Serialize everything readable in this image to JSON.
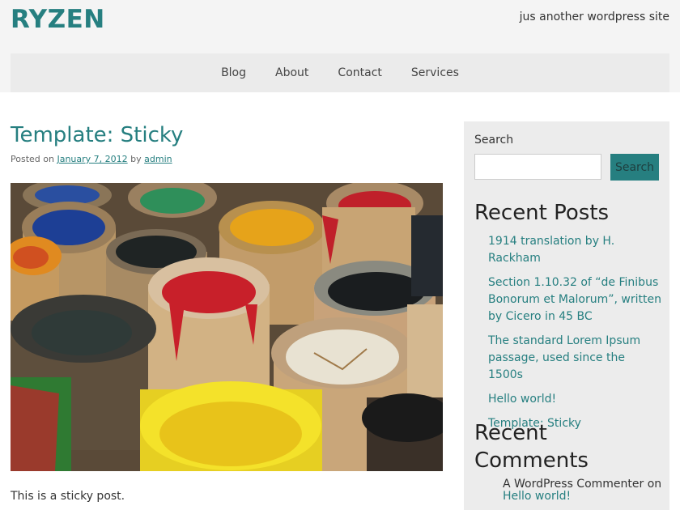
{
  "site": {
    "title": "RYZEN",
    "tagline": "jus another wordpress site"
  },
  "nav": {
    "items": [
      "Blog",
      "About",
      "Contact",
      "Services"
    ]
  },
  "post": {
    "title": "Template: Sticky",
    "meta_prefix": "Posted on",
    "date": "January 7, 2012",
    "by": "by",
    "author": "admin",
    "body": "This is a sticky post."
  },
  "sidebar": {
    "search_label": "Search",
    "search_button": "Search",
    "recent_posts_title": "Recent Posts",
    "recent_posts": [
      "1914 translation by H. Rackham",
      "Section 1.10.32 of “de Finibus Bonorum et Malorum”, written by Cicero in 45 BC",
      "The standard Lorem Ipsum passage, used since the 1500s",
      "Hello world!",
      "Template: Sticky"
    ],
    "recent_comments_title_line1": "Recent",
    "recent_comments_title_line2": "Comments",
    "comment_author": "A WordPress Commenter",
    "comment_on": "on",
    "comment_post": "Hello world!"
  },
  "colors": {
    "accent": "#267f80",
    "header_bg": "#f4f4f4",
    "nav_bg": "#ebebeb",
    "sidebar_bg": "#ececec"
  },
  "icons": {
    "post_image": "paint-buckets-image"
  }
}
